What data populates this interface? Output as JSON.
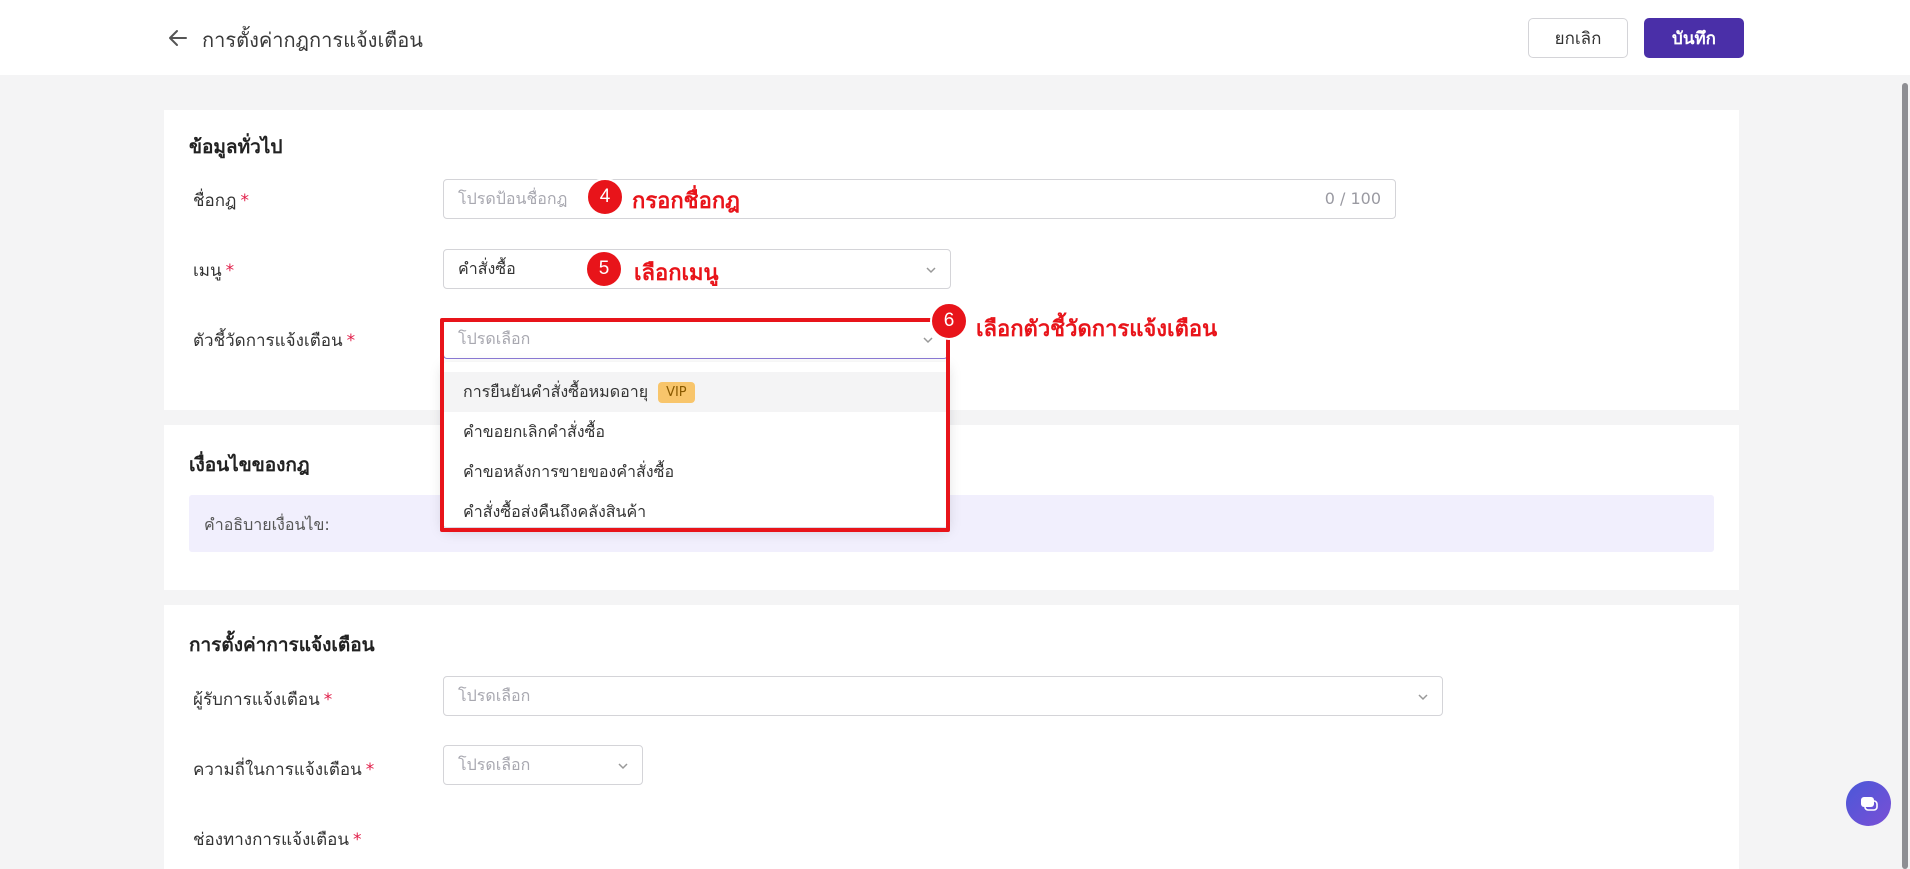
{
  "header": {
    "title": "การตั้งค่ากฎการแจ้งเตือน",
    "cancel_label": "ยกเลิก",
    "save_label": "บันทึก"
  },
  "general": {
    "title": "ข้อมูลทั่วไป",
    "rule_name": {
      "label": "ชื่อกฎ",
      "placeholder": "โปรดป้อนชื่อกฎ",
      "counter": "0 / 100"
    },
    "menu": {
      "label": "เมนู",
      "value": "คำสั่งซื้อ"
    },
    "indicator": {
      "label": "ตัวชี้วัดการแจ้งเตือน",
      "placeholder": "โปรดเลือก",
      "options": [
        {
          "label": "การยืนยันคำสั่งซื้อหมดอายุ",
          "badge": "VIP"
        },
        {
          "label": "คำขอยกเลิกคำสั่งซื้อ"
        },
        {
          "label": "คำขอหลังการขายของคำสั่งซื้อ"
        },
        {
          "label": "คำสั่งซื้อส่งคืนถึงคลังสินค้า"
        }
      ]
    }
  },
  "conditions": {
    "title": "เงื่อนไขของกฎ",
    "desc_label": "คำอธิบายเงื่อนไข:"
  },
  "alert_settings": {
    "title": "การตั้งค่าการแจ้งเตือน",
    "recipient": {
      "label": "ผู้รับการแจ้งเตือน",
      "placeholder": "โปรดเลือก"
    },
    "frequency": {
      "label": "ความถี่ในการแจ้งเตือน",
      "placeholder": "โปรดเลือก"
    },
    "channel": {
      "label": "ช่องทางการแจ้งเตือน"
    }
  },
  "required_mark": "*",
  "annotations": [
    {
      "number": "4",
      "text": "กรอกชื่อกฎ"
    },
    {
      "number": "5",
      "text": "เลือกเมนู"
    },
    {
      "number": "6",
      "text": "เลือกตัวชี้วัดการแจ้งเตือน"
    }
  ],
  "colors": {
    "primary": "#4a2fa8",
    "annotation_red": "#e8141a",
    "required": "#e11d48",
    "vip_badge": "#f8c56b"
  }
}
